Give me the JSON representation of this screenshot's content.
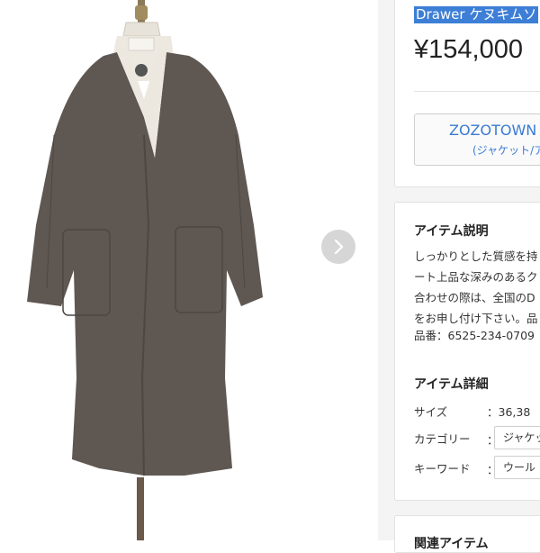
{
  "product": {
    "title": "Drawer ケヌキムソ",
    "price": "¥154,000",
    "image_alt": "coat"
  },
  "gallery": {
    "next_icon": "chevron-right-icon"
  },
  "zozo_button": {
    "label": "ZOZOTOWN",
    "sublabel": "(ジャケット/ア"
  },
  "description": {
    "heading": "アイテム説明",
    "lines": [
      "しっかりとした質感を持",
      "ート上品な深みのあるク",
      "合わせの際は、全国のD",
      "をお申し付け下さい。品",
      "品番：6525-234-0709"
    ]
  },
  "details": {
    "heading": "アイテム詳細",
    "size_label": "サイズ",
    "size_value": "：36,38",
    "category_label": "カテゴリー",
    "category_value": "：",
    "category_tag": "ジャケッ",
    "keyword_label": "キーワード",
    "keyword_value": "：",
    "keyword_tag": "ウール"
  },
  "related": {
    "heading": "関連アイテム"
  },
  "colors": {
    "accent": "#3a7bd5",
    "highlight": "#3d7fd6",
    "coat": "#5f5752"
  }
}
